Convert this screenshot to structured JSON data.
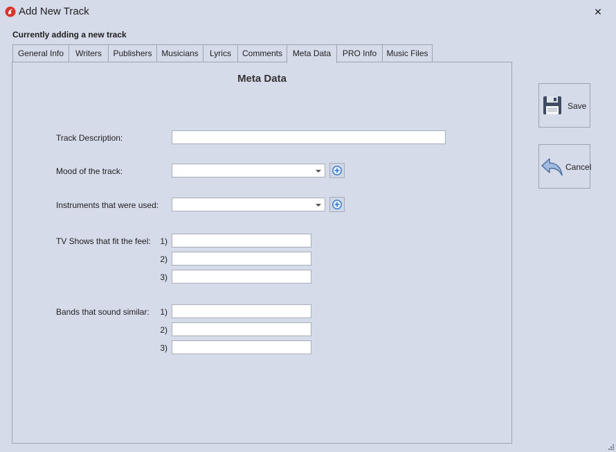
{
  "window": {
    "title": "Add New Track",
    "close_glyph": "✕"
  },
  "subtitle": "Currently adding a new track",
  "tabs": [
    {
      "label": "General Info"
    },
    {
      "label": "Writers"
    },
    {
      "label": "Publishers"
    },
    {
      "label": "Musicians"
    },
    {
      "label": "Lyrics"
    },
    {
      "label": "Comments"
    },
    {
      "label": "Meta Data"
    },
    {
      "label": "PRO Info"
    },
    {
      "label": "Music Files"
    }
  ],
  "active_tab": "Meta Data",
  "panel": {
    "title": "Meta Data",
    "track_description": {
      "label": "Track Description:",
      "value": ""
    },
    "mood": {
      "label": "Mood of the track:",
      "value": ""
    },
    "instruments": {
      "label": "Instruments that were used:",
      "value": ""
    },
    "tv_shows": {
      "label": "TV Shows that fit the feel:",
      "items": [
        {
          "num": "1)",
          "value": ""
        },
        {
          "num": "2)",
          "value": ""
        },
        {
          "num": "3)",
          "value": ""
        }
      ]
    },
    "bands": {
      "label": "Bands that sound similar:",
      "items": [
        {
          "num": "1)",
          "value": ""
        },
        {
          "num": "2)",
          "value": ""
        },
        {
          "num": "3)",
          "value": ""
        }
      ]
    }
  },
  "actions": {
    "save_label": "Save",
    "cancel_label": "Cancel"
  },
  "icons": {
    "app": "app-logo-icon",
    "add": "plus-circle-icon",
    "save": "floppy-disk-icon",
    "cancel": "undo-arrow-icon",
    "dropdown": "chevron-down-icon"
  },
  "colors": {
    "background": "#d6dbe9",
    "border": "#9aa3b3",
    "accent": "#2f72c8",
    "brand": "#d9362b"
  }
}
